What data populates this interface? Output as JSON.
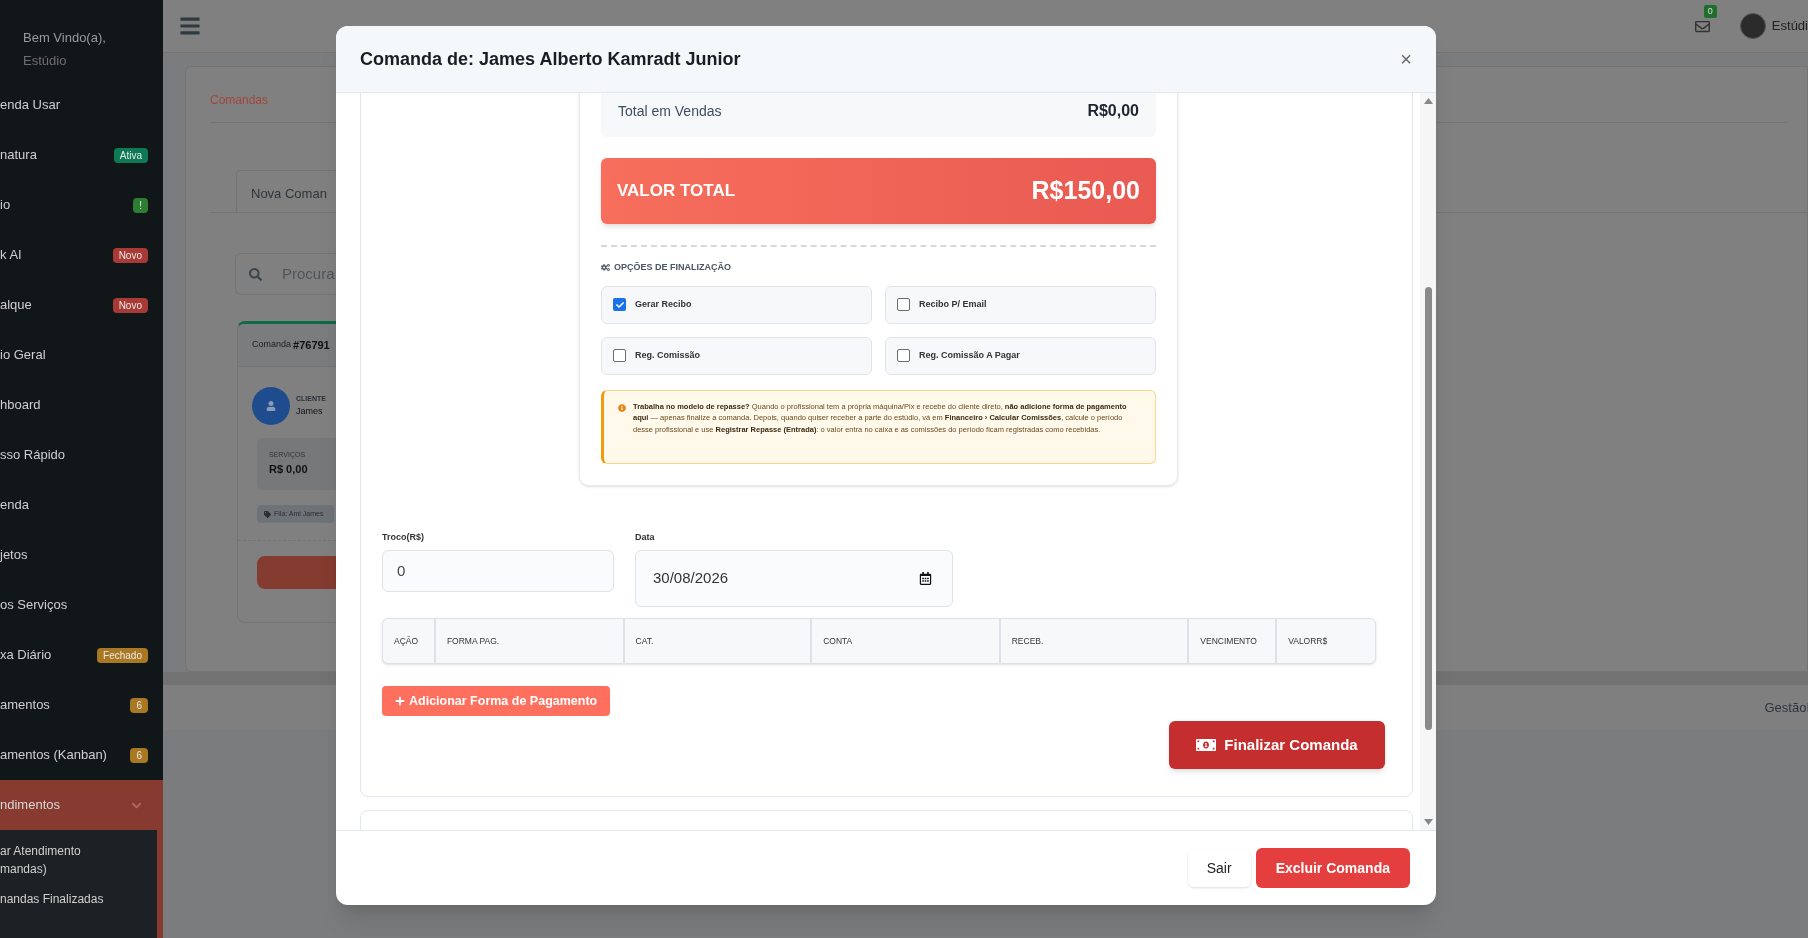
{
  "sidebar": {
    "greeting": "Bem Vindo(a),",
    "user": "Estúdio",
    "items": [
      {
        "label": "enda Usar",
        "selected": false
      },
      {
        "label": "natura",
        "selected": false,
        "badge": {
          "text": "Ativa",
          "color": "#0d7a55"
        }
      },
      {
        "label": "io",
        "selected": false,
        "badge": {
          "text": "!",
          "color": "#2f7d32"
        }
      },
      {
        "label": "k AI",
        "selected": false,
        "badge": {
          "text": "Novo",
          "color": "#a83a36"
        }
      },
      {
        "label": "alque",
        "selected": false,
        "badge": {
          "text": "Novo",
          "color": "#a83a36"
        }
      },
      {
        "label": "io Geral",
        "selected": false
      },
      {
        "label": "hboard",
        "selected": false
      },
      {
        "label": "sso Rápido",
        "selected": false
      },
      {
        "label": "enda",
        "selected": false
      },
      {
        "label": "jetos",
        "selected": false
      },
      {
        "label": "os Serviços",
        "selected": false
      },
      {
        "label": "xa Diário",
        "selected": false,
        "badge": {
          "text": "Fechado",
          "color": "#a97822"
        }
      },
      {
        "label": "amentos",
        "selected": false,
        "badge": {
          "text": "6",
          "color": "#a97822"
        }
      },
      {
        "label": "amentos (Kanban)",
        "selected": false,
        "badge": {
          "text": "6",
          "color": "#a97822"
        }
      },
      {
        "label": "ndimentos",
        "selected": true,
        "expanded": true
      }
    ],
    "sub_items": [
      "ar Atendimento\nmandas)",
      "nandas Finalizadas"
    ]
  },
  "topbar": {
    "mail_count": "0",
    "user": "Estúdi"
  },
  "background": {
    "breadcrumb": "Comandas",
    "tab": "Nova Coman",
    "search_placeholder": "Procura",
    "card": {
      "title_prefix": "Comanda",
      "number": "#76791",
      "client_label": "CLIENTE",
      "client": "James",
      "services_label": "SERVIÇOS",
      "services_value": "R$ 0,00",
      "tag": "Fila: Ami James"
    },
    "footer": "GestãoI"
  },
  "modal": {
    "title": "Comanda de: James Alberto Kamradt Junior",
    "close": "×",
    "total_sales_label": "Total em Vendas",
    "total_sales_value": "R$0,00",
    "total_label": "VALOR TOTAL",
    "total_value": "R$150,00",
    "options_title": "OPÇÕES DE FINALIZAÇÃO",
    "options": [
      {
        "label": "Gerar Recibo",
        "checked": true
      },
      {
        "label": "Recibo P/ Email",
        "checked": false
      },
      {
        "label": "Reg. Comissão",
        "checked": false
      },
      {
        "label": "Reg. Comissão A Pagar",
        "checked": false
      }
    ],
    "notice": "**Trabalha no modelo de repasse?** Quando o profissional tem a própria máquina/Pix e recebe do cliente direto, **não adicione forma de pagamento aqui** — apenas finalize a comanda. Depois, quando quiser receber a parte do estúdio, vá em **Financeiro › Calcular Comissões**, calcule o período desse profissional e use **Registrar Repasse (Entrada)**: o valor entra no caixa e as comissões do período ficam registradas como recebidas.",
    "change_label": "Troco(R$)",
    "change_value": "0",
    "date_label": "Data",
    "date_value": "30/08/2026",
    "table_columns": [
      "AÇÃO",
      "FORMA PAG.",
      "CAT.",
      "CONTA",
      "RECEB.",
      "VENCIMENTO",
      "VALORR$"
    ],
    "add_button": "Adicionar Forma de Pagamento",
    "finish_button": "Finalizar Comanda",
    "buttons": [
      "Sair",
      "Excluir Comanda"
    ]
  }
}
